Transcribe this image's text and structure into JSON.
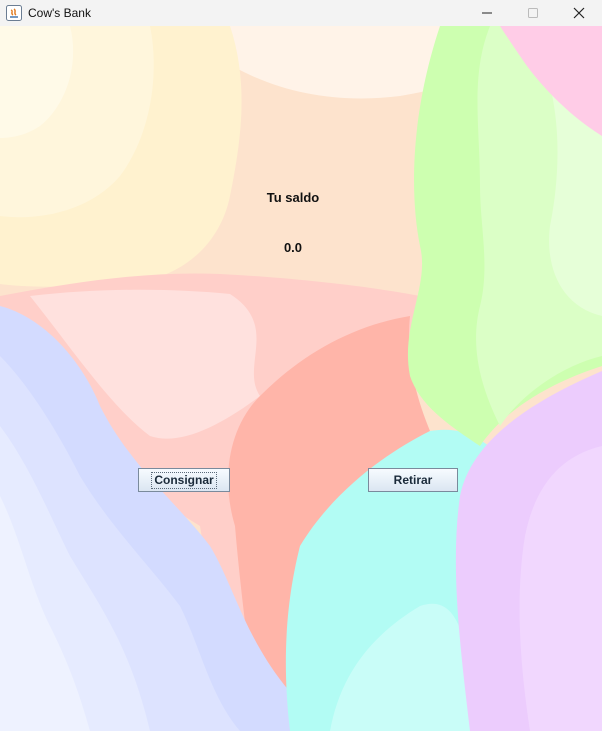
{
  "window": {
    "title": "Cow's Bank",
    "controls": [
      "minimize-icon",
      "maximize-icon",
      "close-icon"
    ]
  },
  "balance": {
    "heading": "Tu saldo",
    "value": "0.0"
  },
  "actions": {
    "deposit_label": "Consignar",
    "withdraw_label": "Retirar"
  },
  "colors": {
    "titlebar": "#f3f3f3",
    "peach": "#fde3cd",
    "salmon": "#ffb8ab",
    "green": "#cdffb0",
    "pink": "#ffcce7",
    "periwinkle": "#d3dbff",
    "aqua": "#b2fcf4",
    "lilac": "#ecccfd",
    "button_top": "#f7fbff",
    "button_bottom": "#dbe6f2"
  }
}
